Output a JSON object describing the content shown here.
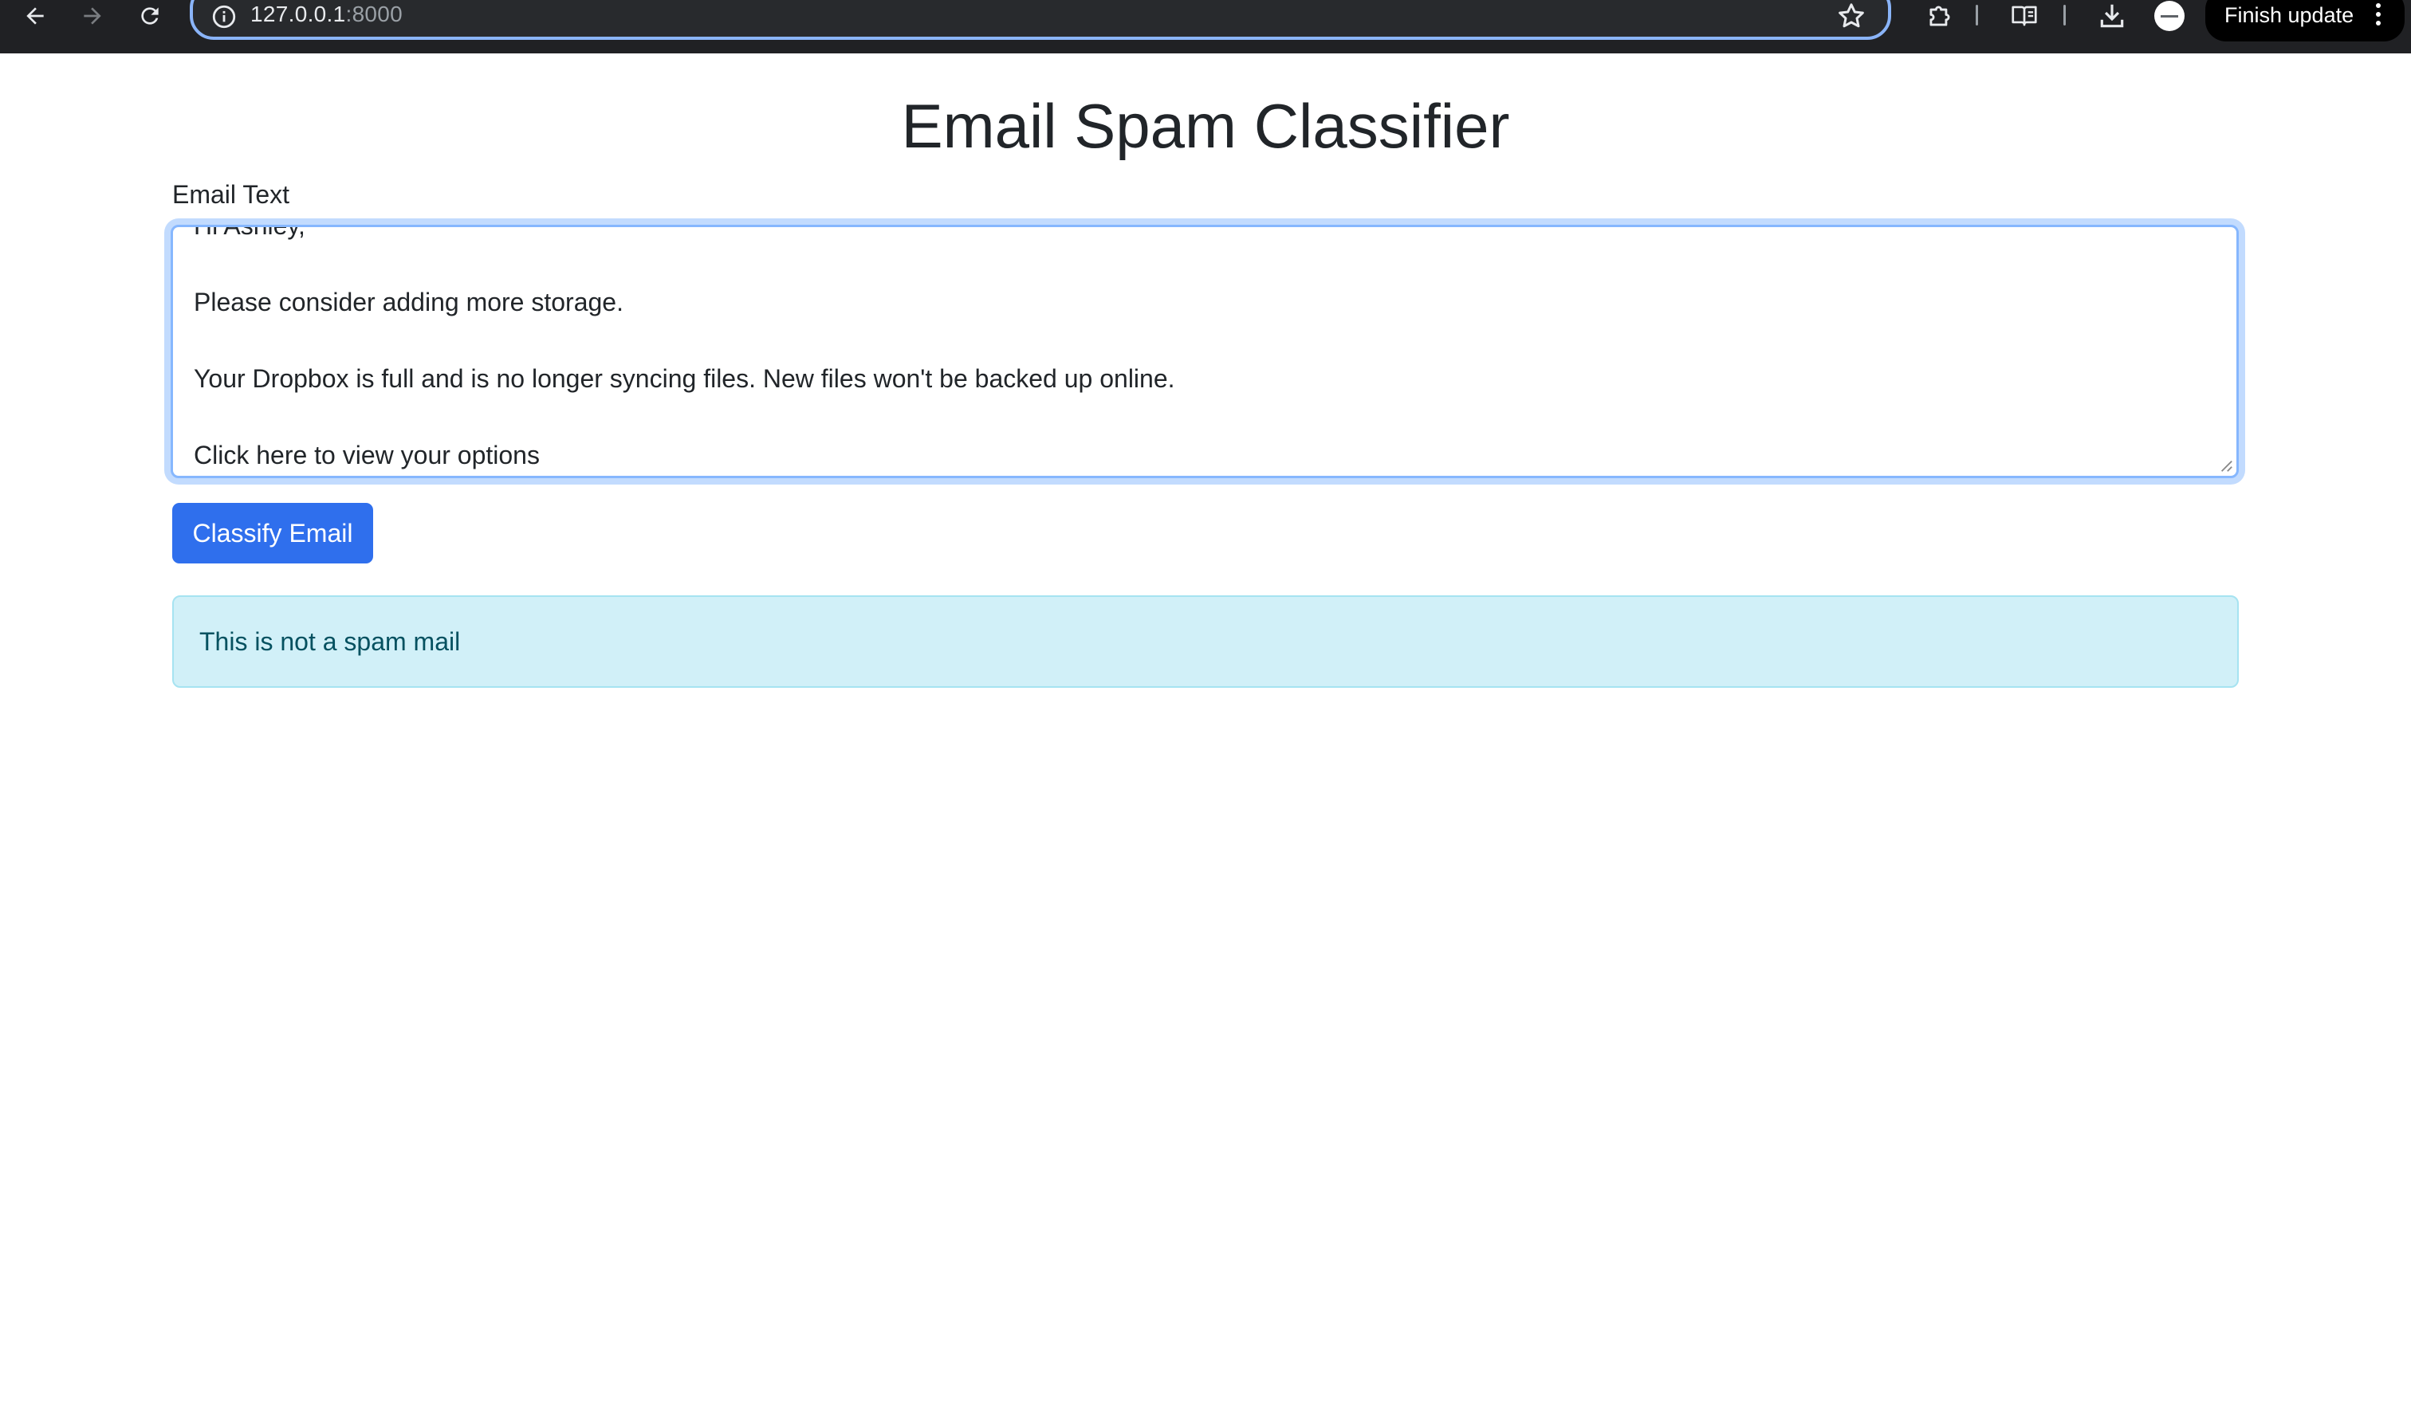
{
  "browser": {
    "url_host": "127.0.0.1",
    "url_port": ":8000",
    "finish_update_label": "Finish update",
    "icons": [
      "back-arrow-icon",
      "forward-arrow-icon",
      "reload-icon",
      "site-info-icon",
      "bookmark-star-icon",
      "extensions-puzzle-icon",
      "reading-list-icon",
      "download-icon",
      "profile-avatar",
      "more-menu-icon"
    ]
  },
  "page": {
    "title": "Email Spam Classifier",
    "email_label": "Email Text",
    "email_text": "Hi Ashley,\n\nPlease consider adding more storage.\n\nYour Dropbox is full and is no longer syncing files. New files won't be backed up online.\n\nClick here to view your options",
    "classify_button_label": "Classify Email",
    "result_message": "This is not a spam mail"
  },
  "colors": {
    "chrome_bg": "#202124",
    "focus_ring": "#86b7fe",
    "primary_button": "#2f6fed",
    "alert_bg": "#d1f0f8",
    "alert_border": "#a6e3f1",
    "alert_text": "#055160",
    "title_text": "#212529"
  }
}
